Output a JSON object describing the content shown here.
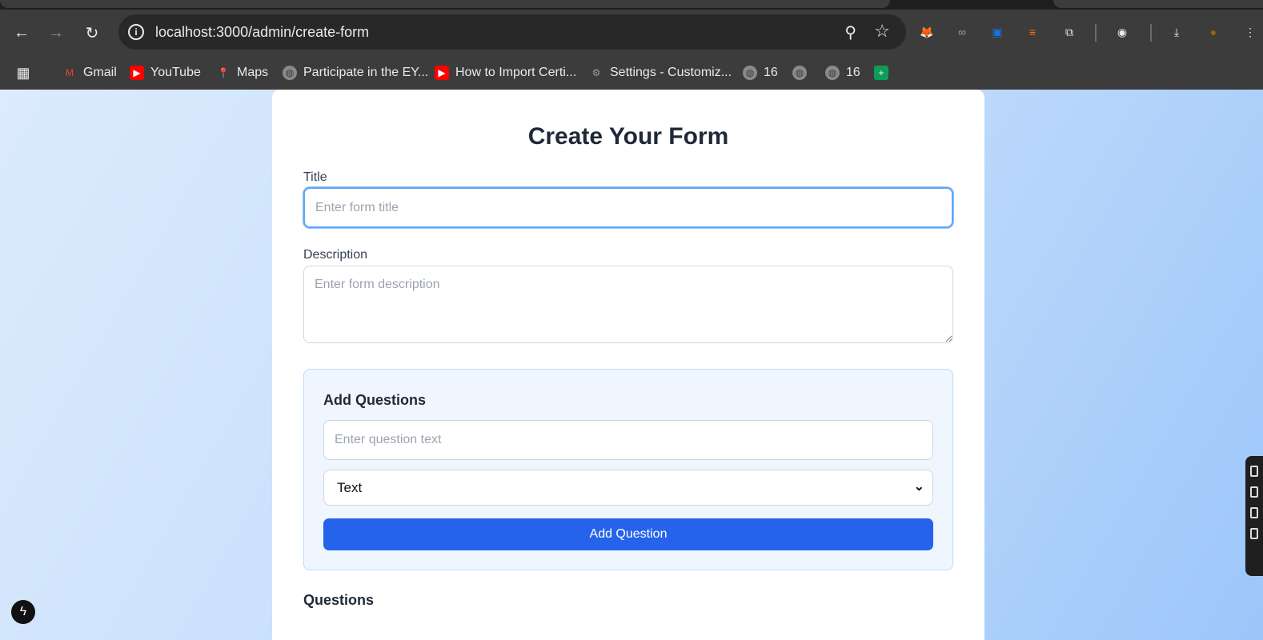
{
  "browser": {
    "url": "localhost:3000/admin/create-form",
    "nav": {
      "back": "←",
      "forward": "→",
      "reload": "↻"
    },
    "icons": {
      "info": "i",
      "zoom": "⚲",
      "star": "☆"
    },
    "extensions": [
      {
        "name": "metamask-extension-icon",
        "glyph": "🦊",
        "color": "#f6851b"
      },
      {
        "name": "spy-extension-icon",
        "glyph": "∞",
        "color": "#9aa0a6"
      },
      {
        "name": "screenshot-extension-icon",
        "glyph": "▣",
        "color": "#1a73e8"
      },
      {
        "name": "notes-extension-icon",
        "glyph": "≡",
        "color": "#f97316"
      },
      {
        "name": "puzzle-extension-icon",
        "glyph": "⧉",
        "color": "#e8eaed"
      },
      {
        "name": "lens-extension-icon",
        "glyph": "◉",
        "color": "#e8eaed"
      },
      {
        "name": "download-icon",
        "glyph": "⤓",
        "color": "#e8eaed"
      },
      {
        "name": "profile-avatar",
        "glyph": "●",
        "color": "#a16207"
      },
      {
        "name": "menu-icon",
        "glyph": "⋮",
        "color": "#e8eaed"
      }
    ]
  },
  "bookmarks": [
    {
      "label": "",
      "icon": "apps-grid-icon",
      "glyph": "▦"
    },
    {
      "label": "Gmail",
      "icon": "gmail-icon",
      "glyph": "M"
    },
    {
      "label": "YouTube",
      "icon": "youtube-icon",
      "glyph": "▶"
    },
    {
      "label": "Maps",
      "icon": "maps-icon",
      "glyph": "📍"
    },
    {
      "label": "Participate in the EY...",
      "icon": "globe-icon",
      "glyph": "◍"
    },
    {
      "label": "How to Import Certi...",
      "icon": "youtube-icon",
      "glyph": "▶"
    },
    {
      "label": "Settings - Customiz...",
      "icon": "gear-icon",
      "glyph": "⚙"
    },
    {
      "label": "16",
      "icon": "globe-icon",
      "glyph": "◍"
    },
    {
      "label": "",
      "icon": "globe-icon",
      "glyph": "◍"
    },
    {
      "label": "16",
      "icon": "globe-icon",
      "glyph": "◍"
    },
    {
      "label": "",
      "icon": "sheets-icon",
      "glyph": "+"
    }
  ],
  "form": {
    "heading": "Create Your Form",
    "title_label": "Title",
    "title_placeholder": "Enter form title",
    "description_label": "Description",
    "description_placeholder": "Enter form description",
    "add_questions": {
      "heading": "Add Questions",
      "question_placeholder": "Enter question text",
      "type_selected": "Text",
      "button_label": "Add Question"
    },
    "questions_heading": "Questions"
  },
  "colors": {
    "primary_button": "#2563eb",
    "focus_ring": "#60a5fa",
    "question_box_bg": "#eff6ff"
  }
}
